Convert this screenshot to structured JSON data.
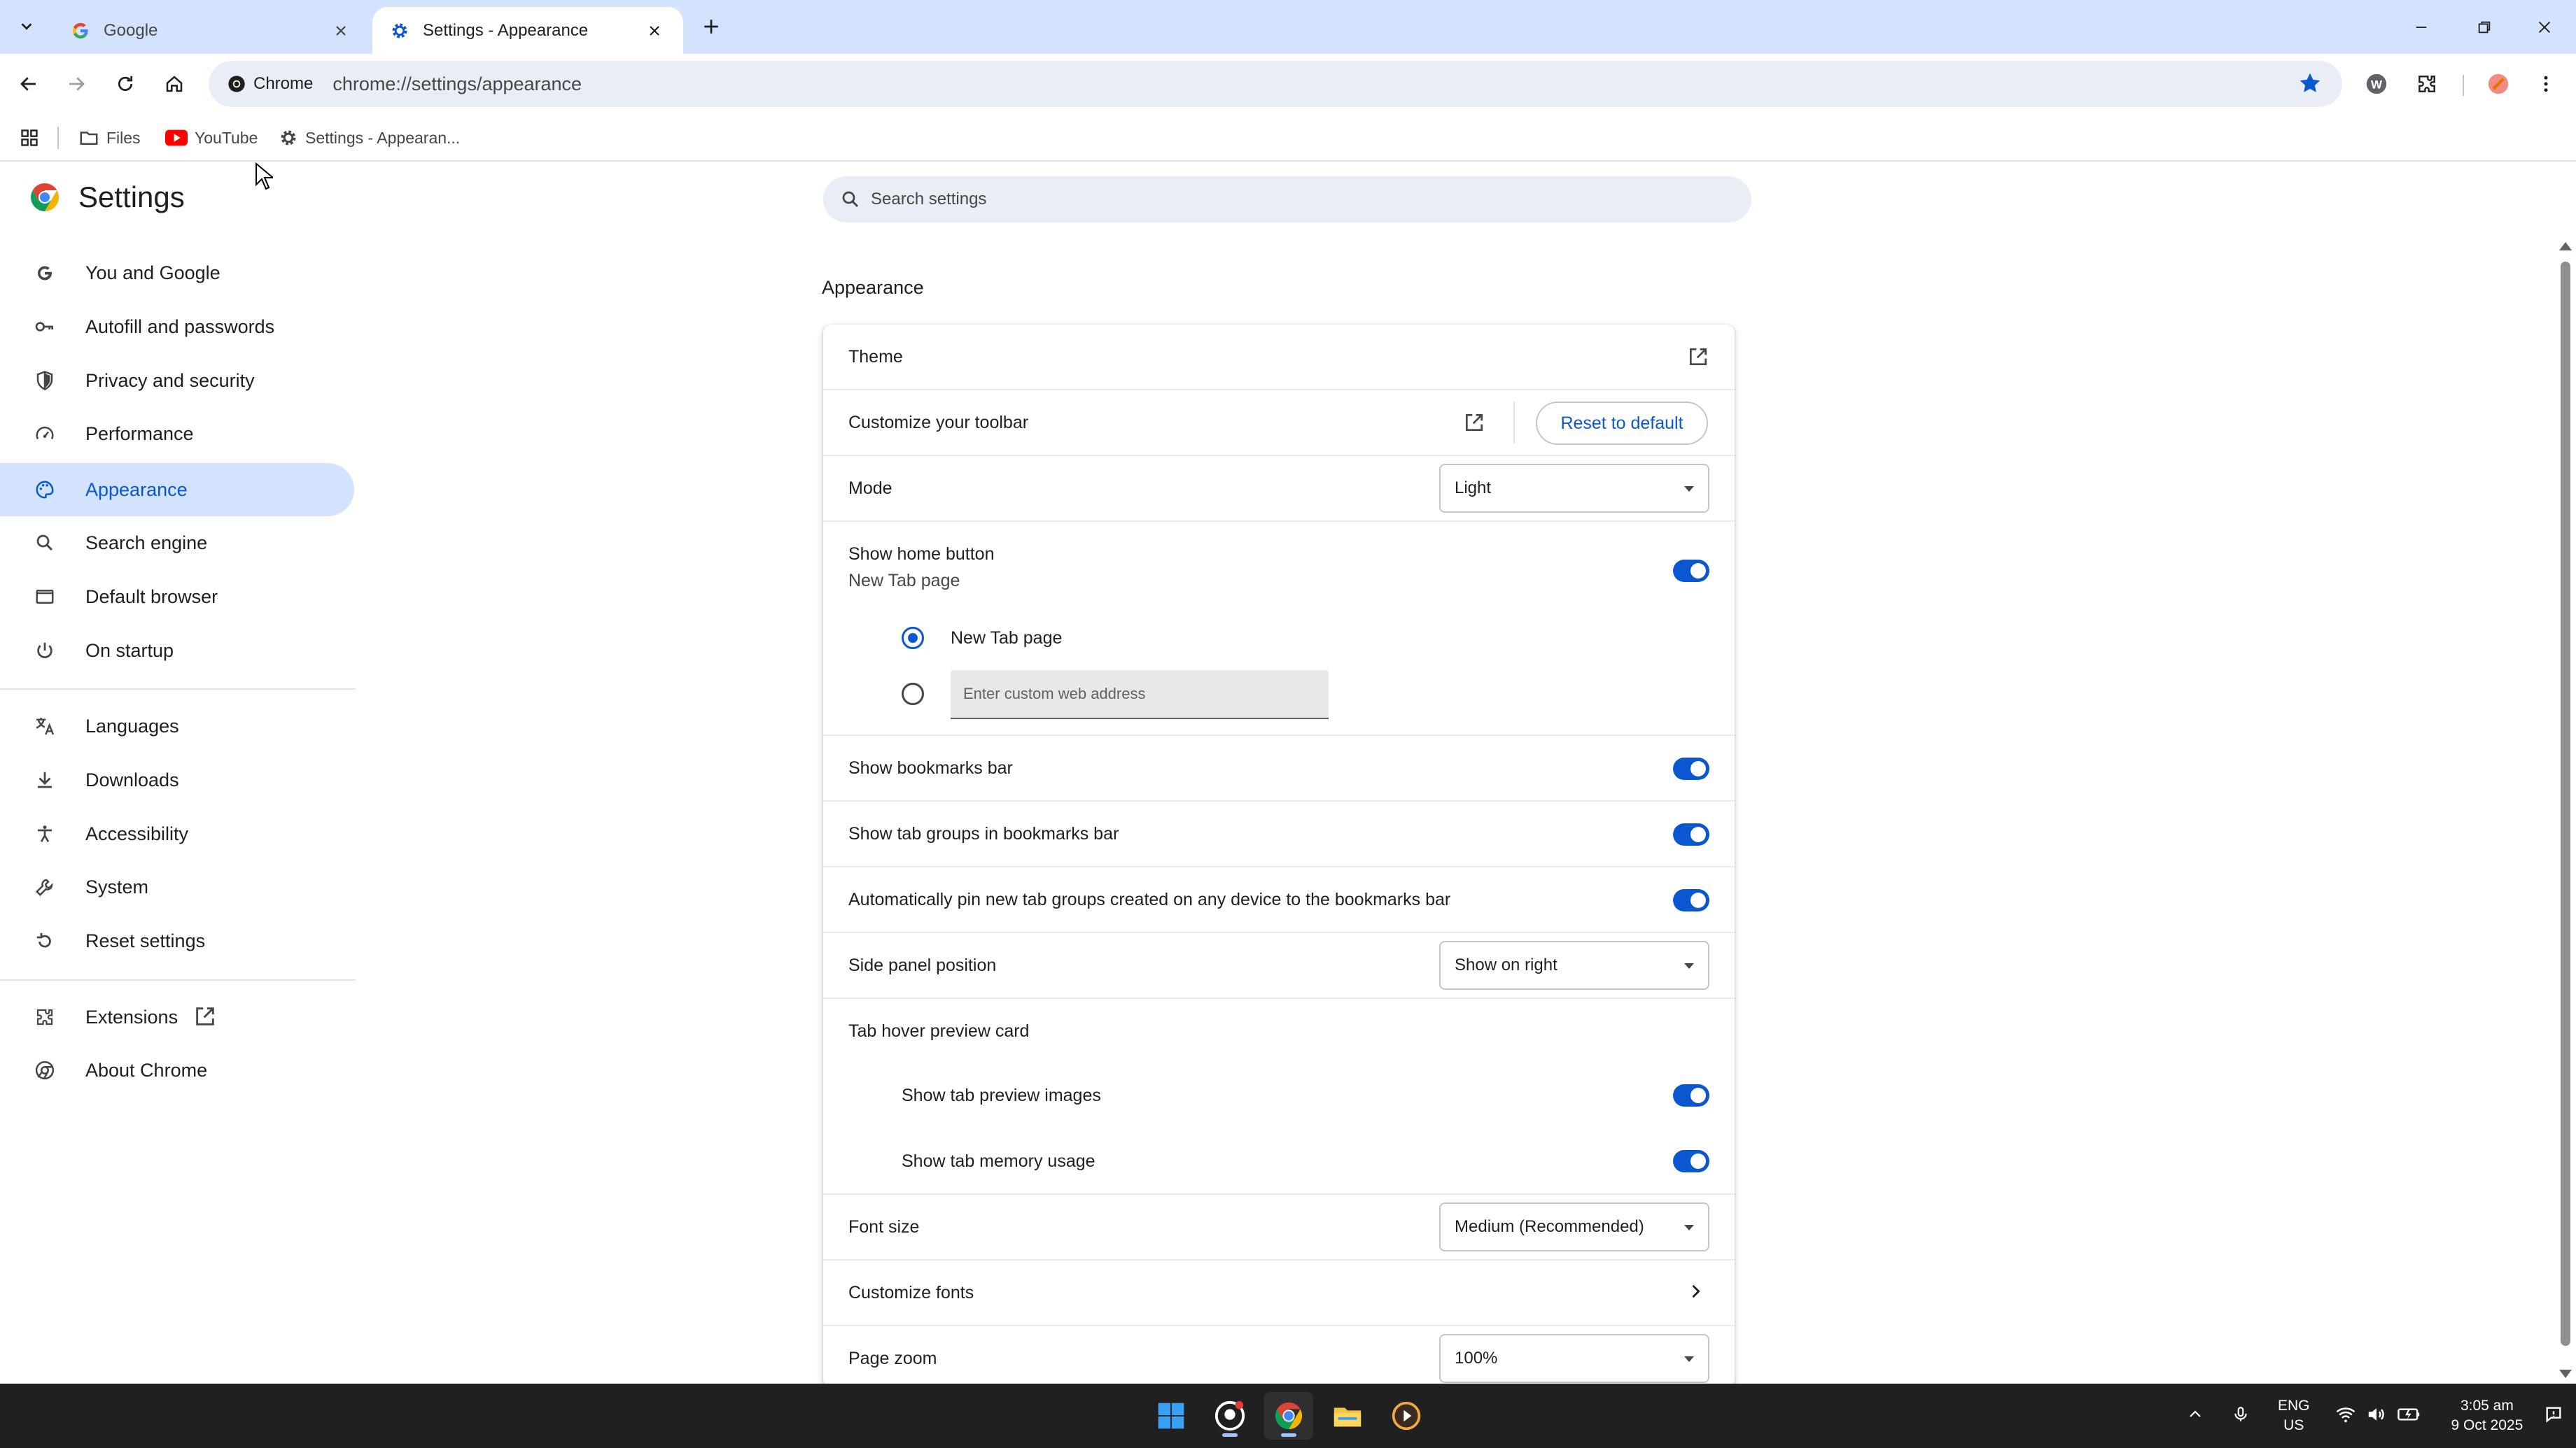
{
  "tabs": [
    {
      "title": "Google",
      "active": false
    },
    {
      "title": "Settings - Appearance",
      "active": true
    }
  ],
  "toolbar": {
    "chip_label": "Chrome",
    "url": "chrome://settings/appearance"
  },
  "bookmarks": [
    {
      "label": "Files",
      "icon": "folder-icon"
    },
    {
      "label": "YouTube",
      "icon": "youtube-icon"
    },
    {
      "label": "Settings - Appearan...",
      "icon": "gear-icon"
    }
  ],
  "settings": {
    "title": "Settings",
    "search_placeholder": "Search settings"
  },
  "nav": {
    "items": [
      {
        "label": "You and Google",
        "icon": "google-g-icon"
      },
      {
        "label": "Autofill and passwords",
        "icon": "key-icon"
      },
      {
        "label": "Privacy and security",
        "icon": "shield-icon"
      },
      {
        "label": "Performance",
        "icon": "speedometer-icon"
      },
      {
        "label": "Appearance",
        "icon": "palette-icon",
        "selected": true
      },
      {
        "label": "Search engine",
        "icon": "search-icon"
      },
      {
        "label": "Default browser",
        "icon": "browser-icon"
      },
      {
        "label": "On startup",
        "icon": "power-icon"
      },
      {
        "label": "Languages",
        "icon": "translate-icon"
      },
      {
        "label": "Downloads",
        "icon": "download-icon"
      },
      {
        "label": "Accessibility",
        "icon": "accessibility-icon"
      },
      {
        "label": "System",
        "icon": "wrench-icon"
      },
      {
        "label": "Reset settings",
        "icon": "reset-icon"
      },
      {
        "label": "Extensions",
        "icon": "puzzle-icon"
      },
      {
        "label": "About Chrome",
        "icon": "chrome-icon"
      }
    ]
  },
  "appearance": {
    "section_title": "Appearance",
    "theme_label": "Theme",
    "toolbar_label": "Customize your toolbar",
    "reset_button": "Reset to default",
    "mode_label": "Mode",
    "mode_value": "Light",
    "home_button_label": "Show home button",
    "home_button_sub": "New Tab page",
    "radio_new_tab": "New Tab page",
    "custom_address_placeholder": "Enter custom web address",
    "bookmarks_bar_label": "Show bookmarks bar",
    "tab_groups_label": "Show tab groups in bookmarks bar",
    "auto_pin_label": "Automatically pin new tab groups created on any device to the bookmarks bar",
    "side_panel_label": "Side panel position",
    "side_panel_value": "Show on right",
    "hover_card_label": "Tab hover preview card",
    "preview_images_label": "Show tab preview images",
    "memory_usage_label": "Show tab memory usage",
    "font_size_label": "Font size",
    "font_size_value": "Medium (Recommended)",
    "customize_fonts_label": "Customize fonts",
    "page_zoom_label": "Page zoom",
    "page_zoom_value": "100%",
    "toggles": {
      "home_button": true,
      "bookmarks_bar": true,
      "tab_groups": true,
      "auto_pin": true,
      "preview_images": true,
      "memory_usage": true
    }
  },
  "taskbar": {
    "lang_top": "ENG",
    "lang_bottom": "US",
    "time": "3:05 am",
    "date": "9 Oct 2025"
  },
  "colors": {
    "accent": "#0b57d0",
    "tabstrip": "#d3e3fd",
    "nav_selected_bg": "#d3e3fd",
    "taskbar": "#202020"
  }
}
